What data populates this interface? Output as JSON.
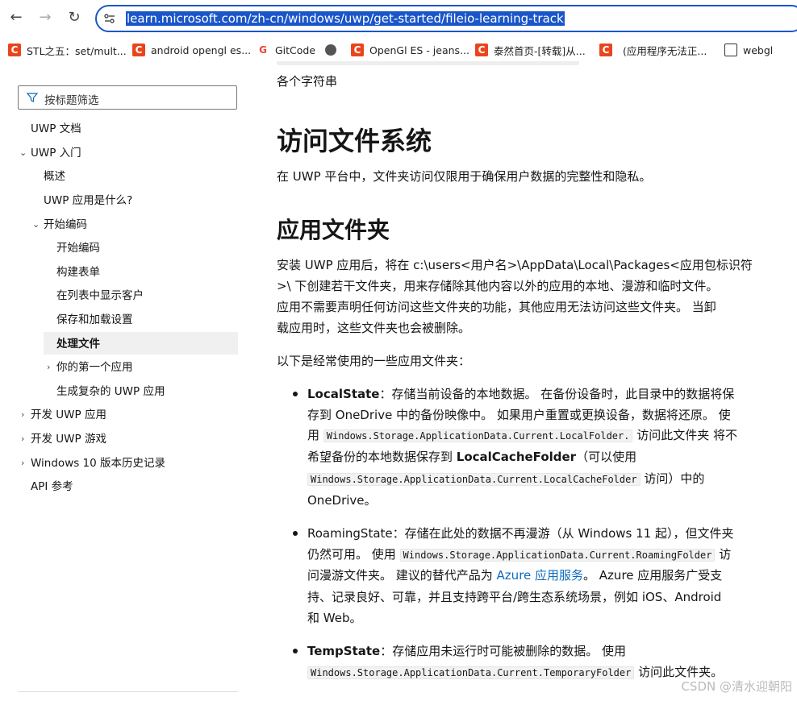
{
  "browser": {
    "url": "learn.microsoft.com/zh-cn/windows/uwp/get-started/fileio-learning-track",
    "bookmarks": [
      {
        "label": "STL之五：set/mult...",
        "icon": "csdn-icon"
      },
      {
        "label": "android opengl es...",
        "icon": "csdn-icon"
      },
      {
        "label": "GitCode",
        "icon": "gitcode-icon"
      },
      {
        "label": "",
        "icon": "globe-icon"
      },
      {
        "label": "OpenGl ES - jeans...",
        "icon": "csdn-icon"
      },
      {
        "label": "泰然首页-[转载]从...",
        "icon": "csdn-icon"
      },
      {
        "label": "(应用程序无法正...",
        "icon": "csdn-icon"
      },
      {
        "label": "webgl",
        "icon": "folder-icon"
      }
    ]
  },
  "sidebar": {
    "filter_placeholder": "按标题筛选",
    "items": [
      {
        "label": "UWP 文档"
      },
      {
        "label": "UWP 入门"
      },
      {
        "label": "概述"
      },
      {
        "label": "UWP 应用是什么?"
      },
      {
        "label": "开始编码"
      },
      {
        "label": "开始编码"
      },
      {
        "label": "构建表单"
      },
      {
        "label": "在列表中显示客户"
      },
      {
        "label": "保存和加载设置"
      },
      {
        "label": "处理文件"
      },
      {
        "label": "你的第一个应用"
      },
      {
        "label": "生成复杂的 UWP 应用"
      },
      {
        "label": "开发 UWP 应用"
      },
      {
        "label": "开发 UWP 游戏"
      },
      {
        "label": "Windows 10 版本历史记录"
      },
      {
        "label": "API 参考"
      }
    ]
  },
  "main": {
    "top_text": "各个字符串",
    "h1": "访问文件系统",
    "intro": "在 UWP 平台中，文件夹访问仅限用于确保用户数据的完整性和隐私。",
    "h2": "应用文件夹",
    "p1_line1": "安装 UWP 应用后，将在 c:\\users<用户名>\\AppData\\Local\\Packages<应用包标识符",
    "p1_line2": ">\\ 下创建若干文件夹，用来存储除其他内容以外的应用的本地、漫游和临时文件。",
    "p1_line3": "应用不需要声明任何访问这些文件夹的功能，其他应用无法访问这些文件夹。 当卸",
    "p1_line4": "载应用时，这些文件夹也会被删除。",
    "p2": "以下是经常使用的一些应用文件夹：",
    "li1": {
      "term": "LocalState",
      "l1": "：存储当前设备的本地数据。 在备份设备时，此目录中的数据将保",
      "l2": "存到 OneDrive 中的备份映像中。 如果用户重置或更换设备，数据将还原。 使",
      "l3_pre": "用 ",
      "code1": "Windows.Storage.ApplicationData.Current.LocalFolder.",
      "l3_post": " 访问此文件夹 将不",
      "l4_pre": "希望备份的本地数据保存到 ",
      "term2": "LocalCacheFolder",
      "l4_post": "（可以使用",
      "code2": "Windows.Storage.ApplicationData.Current.LocalCacheFolder",
      "l5_post": " 访问）中的",
      "l6": "OneDrive。"
    },
    "li2": {
      "term": "RoamingState",
      "l1": "：存储在此处的数据不再漫游（从 Windows 11 起），但文件夹",
      "l2_pre": "仍然可用。 使用 ",
      "code1": "Windows.Storage.ApplicationData.Current.RoamingFolder",
      "l2_post": " 访",
      "l3_pre": "问漫游文件夹。 建议的替代产品为 ",
      "link": "Azure 应用服务",
      "l3_post": "。 Azure 应用服务广受支",
      "l4": "持、记录良好、可靠，并且支持跨平台/跨生态系统场景，例如 iOS、Android",
      "l5": "和 Web。"
    },
    "li3": {
      "term": "TempState",
      "l1": "：存储应用未运行时可能被删除的数据。 使用",
      "code1": "Windows.Storage.ApplicationData.Current.TemporaryFolder",
      "l2_post": " 访问此文件夹。"
    }
  },
  "watermark": "CSDN @清水迎朝阳"
}
